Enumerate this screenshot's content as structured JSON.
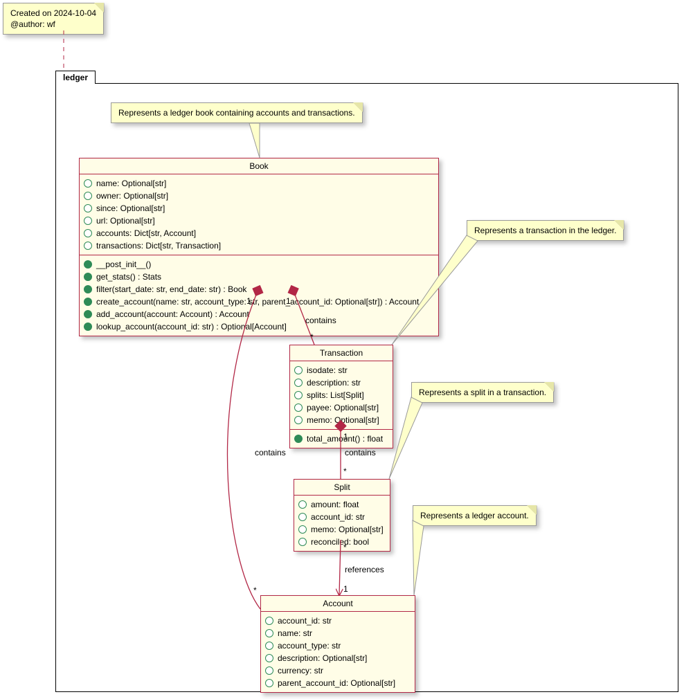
{
  "meta": {
    "note_line1": "Created on 2024-10-04",
    "note_line2": "@author: wf"
  },
  "package": {
    "name": "ledger"
  },
  "notes": {
    "book": "Represents a ledger book containing accounts and transactions.",
    "transaction": "Represents a transaction in the ledger.",
    "split": "Represents a split in a transaction.",
    "account": "Represents a ledger account."
  },
  "classes": {
    "Book": {
      "title": "Book",
      "fields": [
        "name: Optional[str]",
        "owner: Optional[str]",
        "since: Optional[str]",
        "url: Optional[str]",
        "accounts: Dict[str, Account]",
        "transactions: Dict[str, Transaction]"
      ],
      "methods": [
        "__post_init__()",
        "get_stats() : Stats",
        "filter(start_date: str, end_date: str) : Book",
        "create_account(name: str, account_type: str, parent_account_id: Optional[str]) : Account",
        "add_account(account: Account) : Account",
        "lookup_account(account_id: str) : Optional[Account]"
      ]
    },
    "Transaction": {
      "title": "Transaction",
      "fields": [
        "isodate: str",
        "description: str",
        "splits: List[Split]",
        "payee: Optional[str]",
        "memo: Optional[str]"
      ],
      "methods": [
        "total_amount() : float"
      ]
    },
    "Split": {
      "title": "Split",
      "fields": [
        "amount: float",
        "account_id: str",
        "memo: Optional[str]",
        "reconciled: bool"
      ],
      "methods": []
    },
    "Account": {
      "title": "Account",
      "fields": [
        "account_id: str",
        "name: str",
        "account_type: str",
        "description: Optional[str]",
        "currency: str",
        "parent_account_id: Optional[str]"
      ],
      "methods": []
    }
  },
  "relations": {
    "book_transaction": {
      "label": "contains",
      "m1": "1",
      "m2": "*"
    },
    "book_account": {
      "label": "contains",
      "m1": "1",
      "m2": "*"
    },
    "transaction_split": {
      "label": "contains",
      "m1": "1",
      "m2": "*"
    },
    "split_account": {
      "label": "references",
      "m1": "*",
      "m2": "1"
    }
  }
}
